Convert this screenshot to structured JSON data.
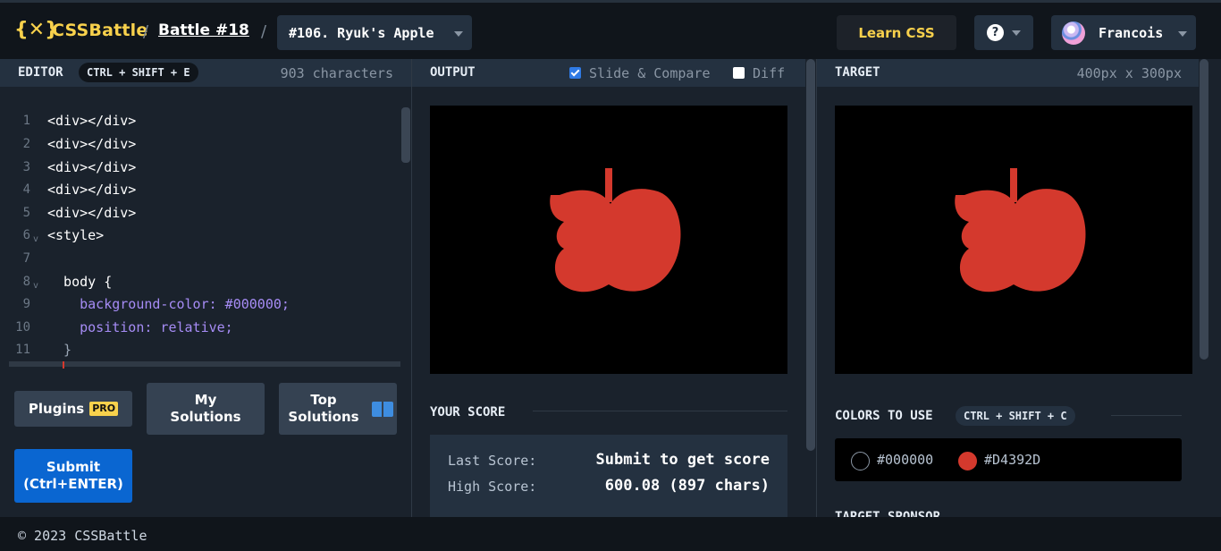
{
  "header": {
    "logo_text": "CSSBattle",
    "logo_mark": "{✕}",
    "separator": "/",
    "battle_label": "Battle #18",
    "target_select": "#106. Ryuk's Apple",
    "learn_label": "Learn CSS",
    "help_icon": "?",
    "user_name": "Francois"
  },
  "editor": {
    "title": "EDITOR",
    "shortcut": "CTRL + SHIFT + E",
    "char_count": "903 characters",
    "lines": [
      {
        "n": "1",
        "code": "<div></div>"
      },
      {
        "n": "2",
        "code": "<div></div>"
      },
      {
        "n": "3",
        "code": "<div></div>"
      },
      {
        "n": "4",
        "code": "<div></div>"
      },
      {
        "n": "5",
        "code": "<div></div>"
      },
      {
        "n": "6",
        "code": "<style>"
      },
      {
        "n": "7",
        "code": ""
      },
      {
        "n": "8",
        "code": "  body {"
      },
      {
        "n": "9",
        "code": "    background-color: #000000;"
      },
      {
        "n": "10",
        "code": "    position: relative;"
      },
      {
        "n": "11",
        "code": "  }"
      }
    ],
    "plugins_label": "Plugins",
    "pro_badge": "PRO",
    "my_solutions_label": "My Solutions",
    "top_solutions_label": "Top Solutions",
    "submit_label": "Submit (Ctrl+ENTER)"
  },
  "output": {
    "title": "OUTPUT",
    "slide_compare_label": "Slide & Compare",
    "slide_compare_checked": true,
    "diff_label": "Diff",
    "diff_checked": false,
    "score_title": "YOUR SCORE",
    "last_score_label": "Last Score:",
    "last_score_value": "Submit to get score",
    "high_score_label": "High Score:",
    "high_score_value": "600.08 (897 chars)"
  },
  "target": {
    "title": "TARGET",
    "dimensions": "400px x 300px",
    "colors_title": "COLORS TO USE",
    "colors_shortcut": "CTRL + SHIFT + C",
    "colors": [
      {
        "hex": "#000000",
        "label": "#000000"
      },
      {
        "hex": "#D4392D",
        "label": "#D4392D"
      }
    ],
    "sponsor_title": "TARGET SPONSOR"
  },
  "footer": {
    "copyright": "© 2023 CSSBattle"
  },
  "theme": {
    "accent_yellow": "#f8d14c",
    "apple_red": "#D4392D",
    "submit_blue": "#0a66d1"
  }
}
